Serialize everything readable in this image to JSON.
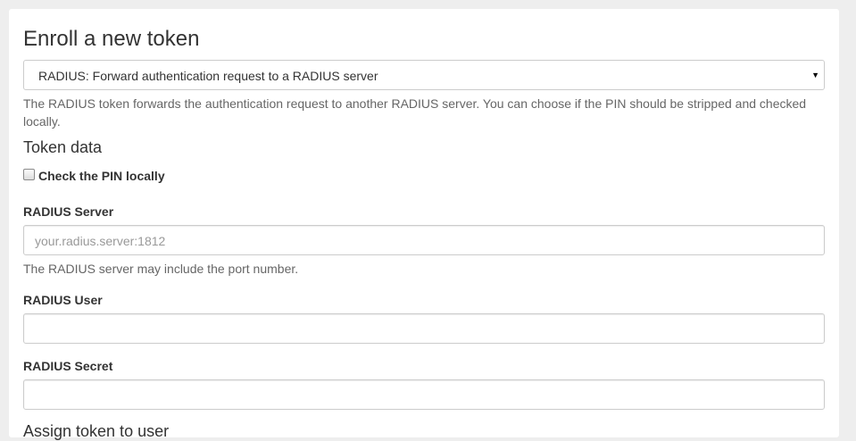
{
  "form": {
    "title": "Enroll a new token",
    "token_type_selected": "RADIUS: Forward authentication request to a RADIUS server",
    "description": "The RADIUS token forwards the authentication request to another RADIUS server. You can choose if the PIN should be stripped and checked locally.",
    "section_title": "Token data",
    "check_pin_label": "Check the PIN locally",
    "check_pin_checked": false,
    "radius_server": {
      "label": "RADIUS Server",
      "placeholder": "your.radius.server:1812",
      "value": "",
      "help": "The RADIUS server may include the port number."
    },
    "radius_user": {
      "label": "RADIUS User",
      "value": ""
    },
    "radius_secret": {
      "label": "RADIUS Secret",
      "value": ""
    },
    "next_section_title": "Assign token to user"
  },
  "icons": {
    "select_arrow": "dropdown-arrow-icon"
  }
}
